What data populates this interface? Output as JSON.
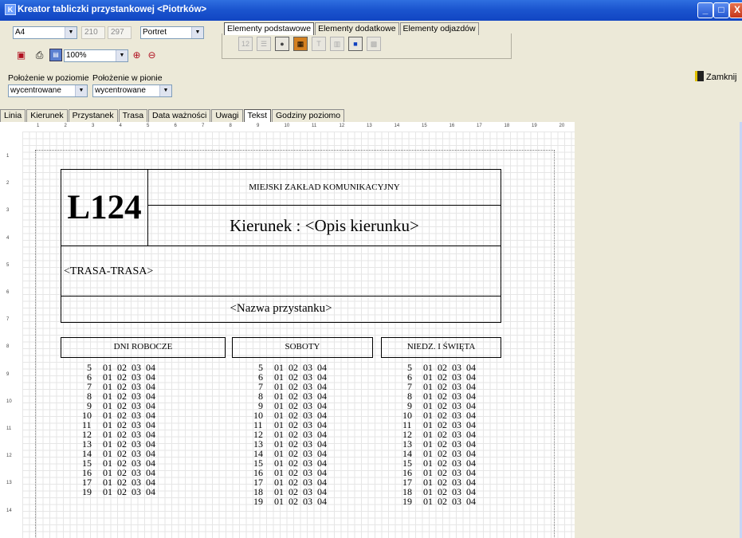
{
  "window": {
    "title": "Kreator tabliczki przystankowej <Piotrków>",
    "controls": [
      "_",
      "□",
      "X"
    ],
    "colors": {
      "titlebar": "#1b55cf",
      "background": "#ece9d8"
    }
  },
  "toolbar": {
    "paper_size": "A4",
    "width_value": "210",
    "height_value": "297",
    "orientation": "Portret",
    "zoom": "100%",
    "element_tabs": [
      "Elementy podstawowe",
      "Elementy dodatkowe",
      "Elementy odjazdów"
    ],
    "close_label": "Zamknij"
  },
  "position": {
    "horizontal_label": "Położenie w poziomie",
    "horizontal_value": "wycentrowane",
    "vertical_label": "Położenie w pionie",
    "vertical_value": "wycentrowane"
  },
  "page_tabs": [
    "Linia",
    "Kierunek",
    "Przystanek",
    "Trasa",
    "Data ważności",
    "Uwagi",
    "Tekst",
    "Godziny poziomo"
  ],
  "active_page_tab": "Tekst",
  "ruler": {
    "horizontal": [
      "1",
      "2",
      "3",
      "4",
      "5",
      "6",
      "7",
      "8",
      "9",
      "10",
      "11",
      "12",
      "13",
      "14",
      "15",
      "16",
      "17",
      "18",
      "19",
      "20"
    ],
    "vertical": [
      "1",
      "2",
      "3",
      "4",
      "5",
      "6",
      "7",
      "8",
      "9",
      "10",
      "11",
      "12",
      "13",
      "14"
    ]
  },
  "board": {
    "line_number": "L124",
    "company": "MIEJSKI ZAKŁAD KOMUNIKACYJNY",
    "direction": "Kierunek : <Opis kierunku>",
    "route": "<TRASA-TRASA>",
    "stop_name": "<Nazwa przystanku>",
    "columns": [
      {
        "header": "DNI ROBOCZE",
        "hours": [
          "5",
          "6",
          "7",
          "8",
          "9",
          "10",
          "11",
          "12",
          "13",
          "14",
          "15",
          "16",
          "17",
          "19"
        ],
        "minutes": [
          "01",
          "02",
          "03",
          "04"
        ]
      },
      {
        "header": "SOBOTY",
        "hours": [
          "5",
          "6",
          "7",
          "8",
          "9",
          "10",
          "11",
          "12",
          "13",
          "14",
          "15",
          "16",
          "17",
          "18",
          "19"
        ],
        "minutes": [
          "01",
          "02",
          "03",
          "04"
        ]
      },
      {
        "header": "NIEDZ. I ŚWIĘTA",
        "hours": [
          "5",
          "6",
          "7",
          "8",
          "9",
          "10",
          "11",
          "12",
          "13",
          "14",
          "15",
          "16",
          "17",
          "18",
          "19"
        ],
        "minutes": [
          "01",
          "02",
          "03",
          "04"
        ]
      }
    ]
  }
}
